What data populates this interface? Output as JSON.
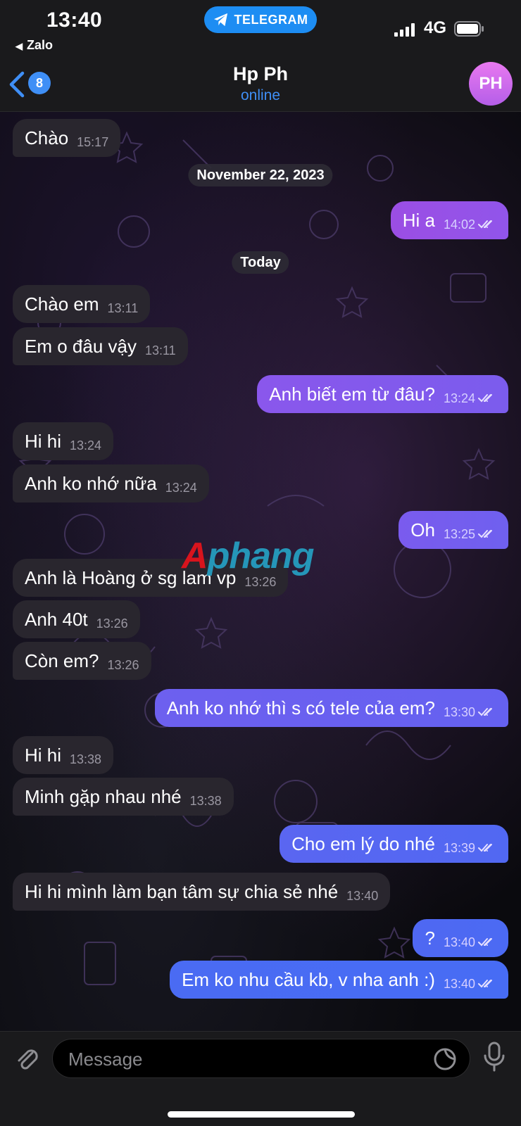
{
  "status_bar": {
    "time": "13:40",
    "back_app": "Zalo",
    "app_pill": "TELEGRAM",
    "network": "4G"
  },
  "header": {
    "unread_count": "8",
    "contact_name": "Hp Ph",
    "contact_status": "online",
    "avatar_initials": "PH"
  },
  "messages": [
    {
      "dir": "in",
      "text": "Chào",
      "time": "15:17"
    },
    {
      "date": "November 22, 2023"
    },
    {
      "dir": "out",
      "text": "Hi a",
      "time": "14:02",
      "read": true
    },
    {
      "date": "Today"
    },
    {
      "dir": "in",
      "text": "Chào em",
      "time": "13:11"
    },
    {
      "dir": "in",
      "text": "Em o đâu vậy",
      "time": "13:11"
    },
    {
      "dir": "out",
      "text": "Anh biết em từ đâu?",
      "time": "13:24",
      "read": true
    },
    {
      "dir": "in",
      "text": "Hi hi",
      "time": "13:24"
    },
    {
      "dir": "in",
      "text": "Anh ko nhớ nữa",
      "time": "13:24"
    },
    {
      "dir": "out",
      "text": "Oh",
      "time": "13:25",
      "read": true
    },
    {
      "dir": "in",
      "text": "Anh là Hoàng ở sg lam vp",
      "time": "13:26"
    },
    {
      "dir": "in",
      "text": "Anh 40t",
      "time": "13:26"
    },
    {
      "dir": "in",
      "text": "Còn em?",
      "time": "13:26"
    },
    {
      "dir": "out",
      "text": "Anh ko nhớ thì s có tele của em?",
      "time": "13:30",
      "read": true
    },
    {
      "dir": "in",
      "text": "Hi hi",
      "time": "13:38"
    },
    {
      "dir": "in",
      "text": "Minh gặp nhau nhé",
      "time": "13:38"
    },
    {
      "dir": "out",
      "text": "Cho em lý do nhé",
      "time": "13:39",
      "read": true
    },
    {
      "dir": "in",
      "text": "Hi hi mình làm bạn tâm sự chia sẻ nhé",
      "time": "13:40"
    },
    {
      "dir": "out",
      "text": "?",
      "time": "13:40",
      "read": true
    },
    {
      "dir": "out",
      "text": "Em ko nhu cầu kb, v nha anh :)",
      "time": "13:40",
      "read": true
    }
  ],
  "watermark": {
    "first": "A",
    "rest": "phang"
  },
  "input": {
    "placeholder": "Message"
  },
  "icons": {
    "back": "chevron-left-icon",
    "telegram": "telegram-plane-icon",
    "attach": "paperclip-icon",
    "sticker": "sticker-icon",
    "mic": "microphone-icon",
    "read": "double-check-icon"
  },
  "colors": {
    "accent": "#3f8ff6",
    "incoming_bubble": "#29262e",
    "outgoing_top": "#8e4fe6",
    "outgoing_bottom": "#4a5cf3",
    "header_bg": "#1a1a1c"
  }
}
